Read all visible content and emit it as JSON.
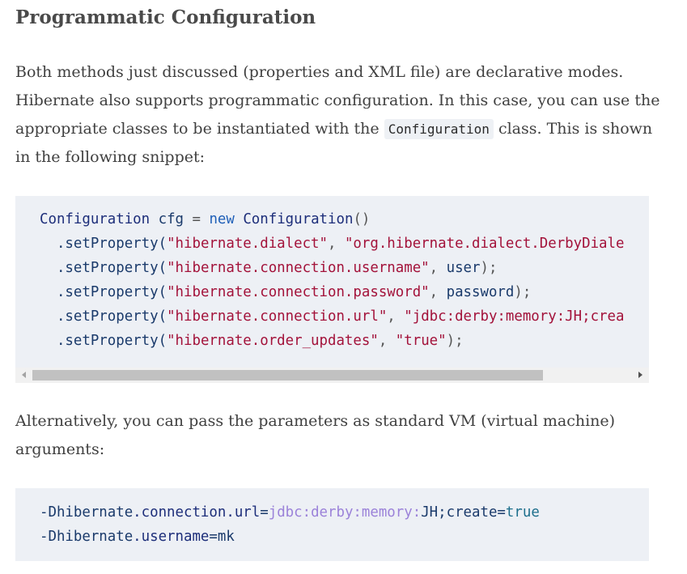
{
  "heading": "Programmatic Configuration",
  "para1": {
    "before": "Both methods just discussed (properties and XML file) are declarative modes. Hibernate also supports programmatic configuration. In this case, you can use the appropriate classes to be instantiated with the ",
    "code": "Configuration",
    "after": " class. This is shown in the following snippet:"
  },
  "code1": {
    "line1": {
      "type1": "Configuration",
      "var": " cfg ",
      "eq": "=",
      "kw": " new ",
      "type2": "Configuration",
      "paren": "()"
    },
    "lines": [
      {
        "method": "  .setProperty(",
        "key": "\"hibernate.dialect\"",
        "sep": ", ",
        "val": "\"org.hibernate.dialect.DerbyDiale",
        "tail": ""
      },
      {
        "method": "  .setProperty(",
        "key": "\"hibernate.connection.username\"",
        "sep": ", ",
        "val": "user",
        "tail": ");"
      },
      {
        "method": "  .setProperty(",
        "key": "\"hibernate.connection.password\"",
        "sep": ", ",
        "val": "password",
        "tail": ");"
      },
      {
        "method": "  .setProperty(",
        "key": "\"hibernate.connection.url\"",
        "sep": ", ",
        "val": "\"jdbc:derby:memory:JH;crea",
        "tail": ""
      },
      {
        "method": "  .setProperty(",
        "key": "\"hibernate.order_updates\"",
        "sep": ", ",
        "val": "\"true\"",
        "tail": ");"
      }
    ]
  },
  "para2": "Alternatively, you can pass the parameters as standard VM (virtual machine) arguments:",
  "code2": {
    "line1": {
      "a": "-Dhibernate",
      "b": ".connection",
      "c": ".url",
      "d": "=",
      "e": "jdbc:derby:memory:",
      "f": "JH;create",
      "g": "=",
      "h": "true"
    },
    "line2": {
      "a": "-Dhibernate",
      "b": ".username",
      "c": "=mk"
    }
  },
  "colors": {
    "string": "#a3123a",
    "keyword": "#2060b8",
    "code_bg": "#edf0f5"
  }
}
